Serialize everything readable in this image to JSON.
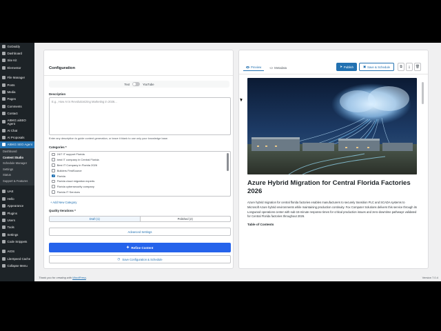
{
  "sidebar": {
    "items": [
      {
        "label": "GoDaddy"
      },
      {
        "label": "Dashboard"
      },
      {
        "label": "Site Kit"
      },
      {
        "label": "Elementor"
      },
      {
        "label": "File Manager"
      },
      {
        "label": "Posts"
      },
      {
        "label": "Media"
      },
      {
        "label": "Pages"
      },
      {
        "label": "Comments"
      },
      {
        "label": "Contact"
      },
      {
        "label": "AIBKG aiSEO"
      },
      {
        "label": "Agent"
      },
      {
        "label": "AI Chat"
      },
      {
        "label": "AI Proposals"
      },
      {
        "label": "AIBKG SEO Agent"
      }
    ],
    "submenu": [
      "Dashboard",
      "Content Studio",
      "Schedule Manager",
      "Settings",
      "Status",
      "Support & Features"
    ],
    "items_after": [
      {
        "label": "UAE"
      },
      {
        "label": "Hello"
      },
      {
        "label": "Appearance"
      },
      {
        "label": "Plugins"
      },
      {
        "label": "Users"
      },
      {
        "label": "Tools"
      },
      {
        "label": "Settings"
      },
      {
        "label": "Code Snippets"
      },
      {
        "label": "AIOS"
      },
      {
        "label": "LiteSpeed Cache"
      },
      {
        "label": "Collapse Menu"
      }
    ]
  },
  "config": {
    "heading": "Configuration",
    "toggle_text": "Text",
    "toggle_youtube": "YouTube",
    "description_label": "Description",
    "description_placeholder": "E.g., How AI is Revolutionizing Marketing in 2026...",
    "description_help": "Enter any description to guide content generation, or leave it blank to use only your knowledge base.",
    "categories_label": "Categories *",
    "categories": [
      {
        "label": "24/7 IT support Florida",
        "checked": false
      },
      {
        "label": "best IT company in Central Florida",
        "checked": false
      },
      {
        "label": "Best IT Company in Florida 2026",
        "checked": false
      },
      {
        "label": "Builders FirstSource",
        "checked": false
      },
      {
        "label": "Florida",
        "checked": true
      },
      {
        "label": "Florida cloud migration experts",
        "checked": false
      },
      {
        "label": "Florida cybersecurity company",
        "checked": false
      },
      {
        "label": "Florida IT Services",
        "checked": false
      }
    ],
    "add_category": "+ Add New Category",
    "quality_label": "Quality Iterations *",
    "quality_options": [
      "Draft (1)",
      "Polished (2)"
    ],
    "advanced_button": "Advanced Settings",
    "refine_button": "Refine Content",
    "save_button": "Save Configuration & Schedule"
  },
  "preview": {
    "tabs": [
      "Preview",
      "Metadata"
    ],
    "publish_button": "Publish",
    "save_schedule_button": "Save & Schedule",
    "title": "Azure Hybrid Migration for Central Florida Factories 2026",
    "body": "Azure hybrid migration for central florida factories enables manufacturers to securely transition PLC and SCADA systems to Microsoft Azure hybrid environments while maintaining production continuity. Fox Computer Solutions delivers this service through its Longwood operations center with sub-15-minute response times for critical production issues and zero-downtime pathways validated for Central Florida factories throughout 2026.",
    "toc": "Table of Contents"
  },
  "footer": {
    "thanks_prefix": "Thank you for creating with ",
    "thanks_link": "WordPress",
    "thanks_suffix": ".",
    "version": "Version 7.0.4"
  },
  "colors": {
    "wp_sidebar": "#1d2327",
    "wp_blue": "#2271b1",
    "refine_blue": "#2563eb"
  }
}
